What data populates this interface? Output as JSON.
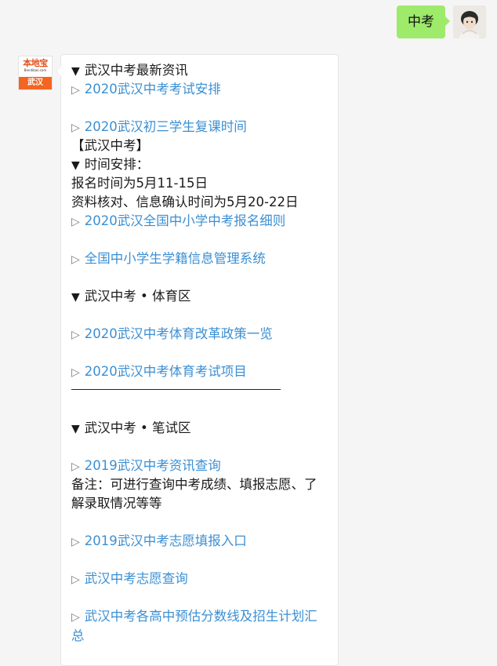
{
  "outgoing": {
    "text": "中考"
  },
  "bot": {
    "logo_text": "本地宝",
    "logo_url": "Bendibao.com",
    "logo_city": "武汉"
  },
  "message": {
    "head_news": "武汉中考最新资讯",
    "link_arrangement": "2020武汉中考考试安排",
    "link_resume": "2020武汉初三学生复课时间",
    "bracket_title": "【武汉中考】",
    "head_schedule": "时间安排：",
    "signup_time": "报名时间为5月11-15日",
    "verify_time": "资料核对、信息确认时间为5月20-22日",
    "link_signup_detail": "2020武汉全国中小学中考报名细则",
    "link_student_system": "全国中小学生学籍信息管理系统",
    "head_sports": "武汉中考 • 体育区",
    "link_sports_policy": "2020武汉中考体育改革政策一览",
    "link_sports_items": "2020武汉中考体育考试项目",
    "head_written": "武汉中考 • 笔试区",
    "link_2019_news": "2019武汉中考资讯查询",
    "note": "备注：可进行查询中考成绩、填报志愿、了解录取情况等等",
    "link_2019_wish": "2019武汉中考志愿填报入口",
    "link_wish_query": "武汉中考志愿查询",
    "link_scores": "武汉中考各高中预估分数线及招生计划汇总"
  },
  "glyphs": {
    "head_triangle": "▼",
    "link_triangle": "▷"
  }
}
